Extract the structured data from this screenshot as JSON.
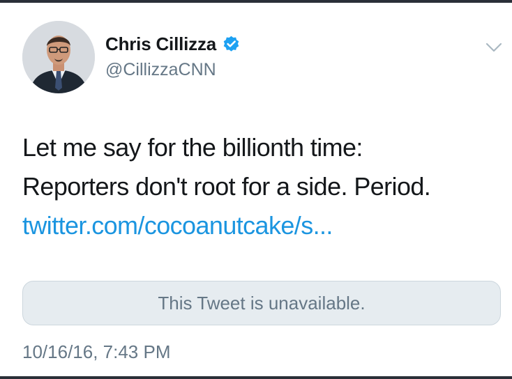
{
  "tweet": {
    "author": {
      "display_name": "Chris Cillizza",
      "handle": "@CillizzaCNN",
      "verified": true,
      "verified_color": "#1da1f2"
    },
    "text_lines": [
      "Let me say for the billionth time:",
      "Reporters don't root for a side. Period."
    ],
    "link": "twitter.com/cocoanutcake/s...",
    "link_color": "#1b95e0",
    "quoted_tweet_notice": "This Tweet is unavailable.",
    "timestamp": "10/16/16, 7:43 PM",
    "menu_icon": "chevron-down-icon"
  }
}
